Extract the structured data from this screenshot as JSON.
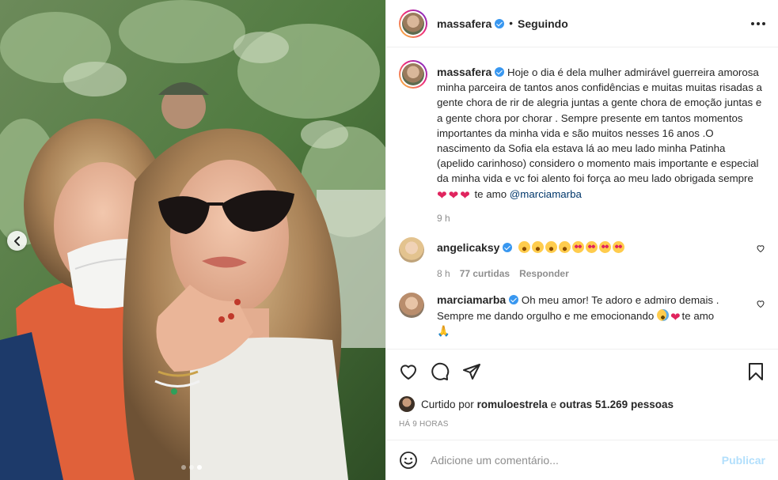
{
  "post": {
    "header": {
      "username": "massafera",
      "separator": "•",
      "follow_status": "Seguindo"
    },
    "caption": {
      "username": "massafera",
      "text": "Hoje o dia é dela mulher admirável guerreira amorosa minha parceira de tantos anos confidências e muitas muitas risadas a gente chora de rir de alegria juntas a gente chora de emoção juntas e a gente chora por chorar . Sempre presente em tantos momentos importantes da minha vida e são muitos nesses 16 anos .O nascimento da Sofia ela estava lá ao meu lado minha Patinha (apelido carinhoso) considero o momento mais importante e especial da minha vida e vc foi alento foi força ao meu lado obrigada sempre",
      "text_after_emoji": "te amo",
      "mention": "@marciamarba",
      "emojis": [
        "heart",
        "heart",
        "heart"
      ],
      "time": "9 h"
    },
    "comments": [
      {
        "username": "angelicaksy",
        "emojis": [
          "laugh",
          "laugh",
          "laugh",
          "laugh",
          "hearteyes",
          "hearteyes",
          "hearteyes",
          "hearteyes"
        ],
        "time": "8 h",
        "likes": "77 curtidas",
        "reply_label": "Responder"
      },
      {
        "username": "marciamarba",
        "text": "Oh meu amor! Te adoro e admiro demais . Sempre me dando orgulho e me emocionando",
        "text_after_emoji": "te amo",
        "trailing_emoji": "🙏"
      }
    ],
    "likes_summary": {
      "prefix": "Curtido por",
      "user": "romuloestrela",
      "connector": "e",
      "others": "outras 51.269 pessoas"
    },
    "timestamp": "Há 9 horas",
    "add_comment": {
      "placeholder": "Adicione um comentário...",
      "publish_label": "Publicar"
    },
    "carousel": {
      "slide_count": 3,
      "active_slide": 3
    }
  },
  "colors": {
    "verified": "#3897f0",
    "link": "#00376b",
    "publish_disabled": "#b2dffc",
    "secondary_text": "#8e8e8e"
  }
}
